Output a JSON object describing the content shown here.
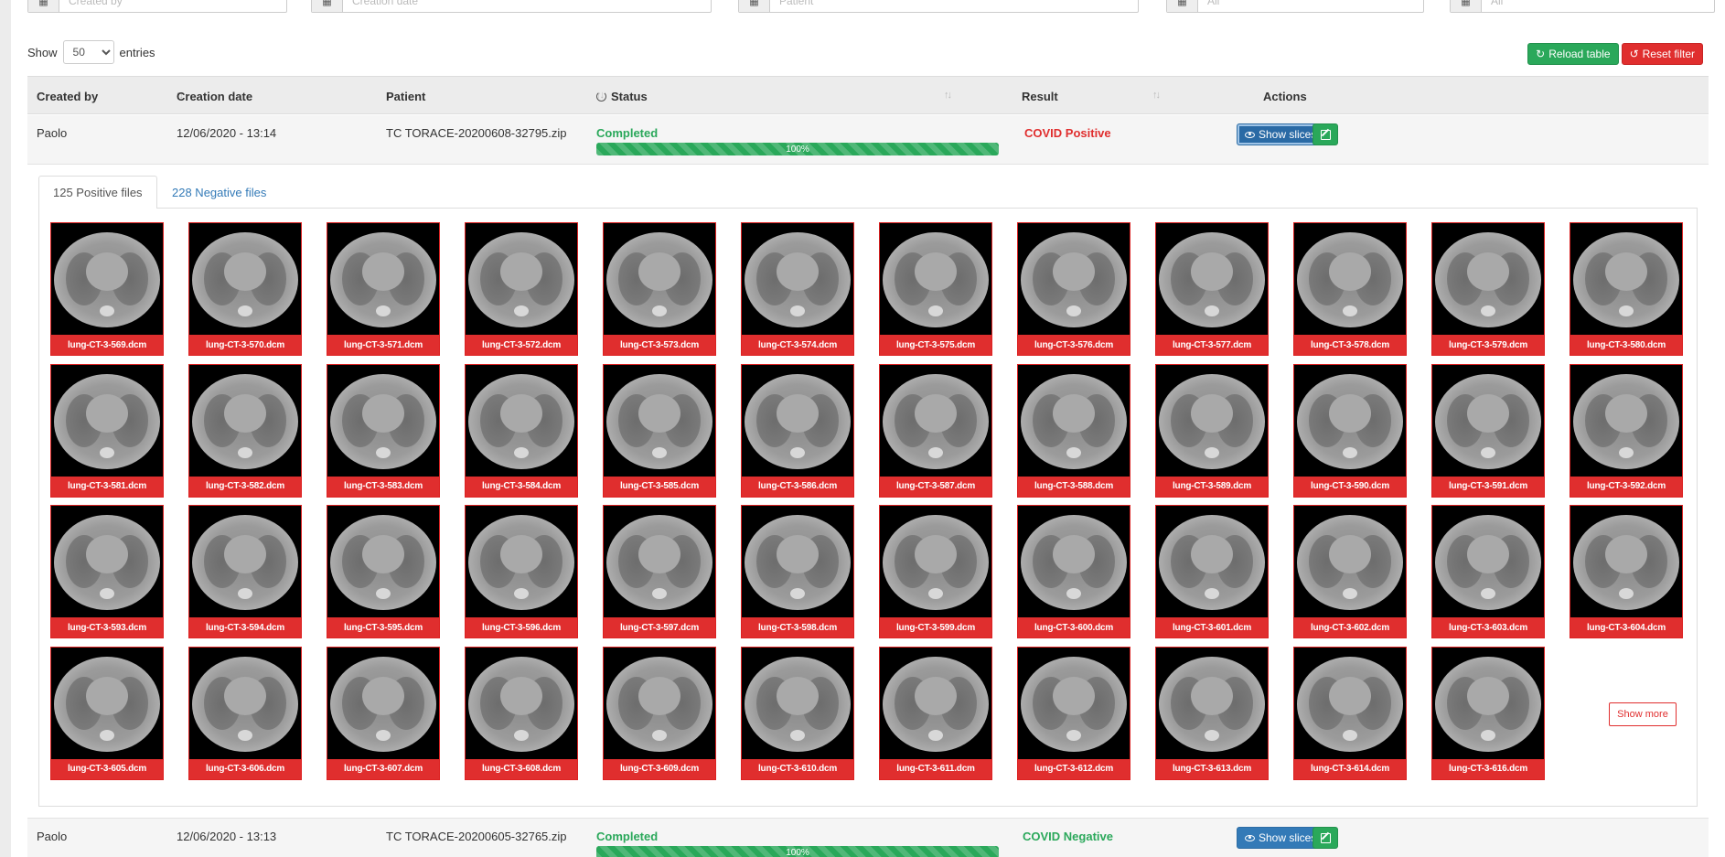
{
  "filters": {
    "created_by_placeholder": "Created by",
    "creation_date_placeholder": "Creation date",
    "patient_placeholder": "Patient",
    "status_placeholder": "All",
    "result_placeholder": "All"
  },
  "entries": {
    "show_label": "Show",
    "value": "50",
    "entries_label": "entries"
  },
  "toolbar": {
    "reload_label": "Reload table",
    "reset_label": "Reset filter"
  },
  "columns": {
    "created_by": "Created by",
    "creation_date": "Creation date",
    "patient": "Patient",
    "status": "Status",
    "result": "Result",
    "actions": "Actions"
  },
  "rows": [
    {
      "created_by": "Paolo",
      "creation_date": "12/06/2020 - 13:14",
      "patient": "TC TORACE-20200608-32795.zip",
      "status": "Completed",
      "progress": "100%",
      "result": "COVID Positive",
      "show_slices": "Show slices"
    },
    {
      "created_by": "Paolo",
      "creation_date": "12/06/2020 - 13:13",
      "patient": "TC TORACE-20200605-32765.zip",
      "status": "Completed",
      "progress": "100%",
      "result": "COVID Negative",
      "show_slices": "Show slices"
    }
  ],
  "tabs": {
    "positive": "125 Positive files",
    "negative": "228 Negative files"
  },
  "files": [
    "lung-CT-3-569.dcm",
    "lung-CT-3-570.dcm",
    "lung-CT-3-571.dcm",
    "lung-CT-3-572.dcm",
    "lung-CT-3-573.dcm",
    "lung-CT-3-574.dcm",
    "lung-CT-3-575.dcm",
    "lung-CT-3-576.dcm",
    "lung-CT-3-577.dcm",
    "lung-CT-3-578.dcm",
    "lung-CT-3-579.dcm",
    "lung-CT-3-580.dcm",
    "lung-CT-3-581.dcm",
    "lung-CT-3-582.dcm",
    "lung-CT-3-583.dcm",
    "lung-CT-3-584.dcm",
    "lung-CT-3-585.dcm",
    "lung-CT-3-586.dcm",
    "lung-CT-3-587.dcm",
    "lung-CT-3-588.dcm",
    "lung-CT-3-589.dcm",
    "lung-CT-3-590.dcm",
    "lung-CT-3-591.dcm",
    "lung-CT-3-592.dcm",
    "lung-CT-3-593.dcm",
    "lung-CT-3-594.dcm",
    "lung-CT-3-595.dcm",
    "lung-CT-3-596.dcm",
    "lung-CT-3-597.dcm",
    "lung-CT-3-598.dcm",
    "lung-CT-3-599.dcm",
    "lung-CT-3-600.dcm",
    "lung-CT-3-601.dcm",
    "lung-CT-3-602.dcm",
    "lung-CT-3-603.dcm",
    "lung-CT-3-604.dcm",
    "lung-CT-3-605.dcm",
    "lung-CT-3-606.dcm",
    "lung-CT-3-607.dcm",
    "lung-CT-3-608.dcm",
    "lung-CT-3-609.dcm",
    "lung-CT-3-610.dcm",
    "lung-CT-3-611.dcm",
    "lung-CT-3-612.dcm",
    "lung-CT-3-613.dcm",
    "lung-CT-3-614.dcm",
    "lung-CT-3-616.dcm"
  ],
  "show_more_label": "Show more",
  "colors": {
    "positive": "#e02e2e",
    "negative": "#2aa85a",
    "primary": "#337ab7"
  }
}
